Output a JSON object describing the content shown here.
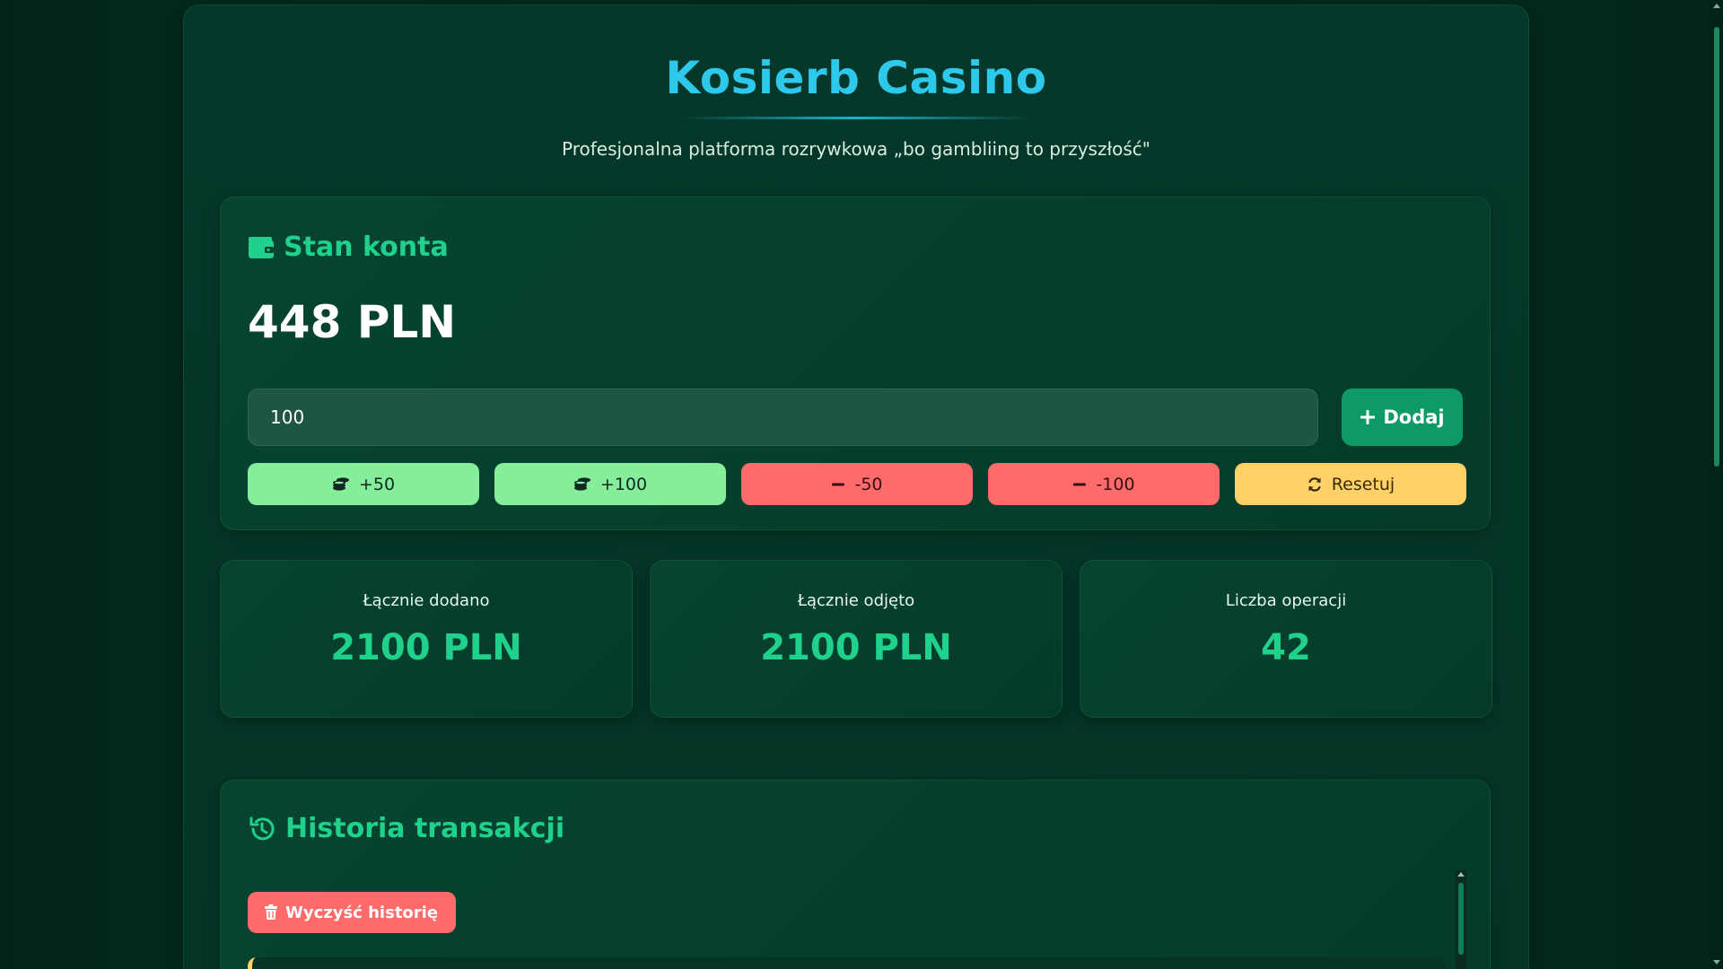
{
  "header": {
    "title": "Kosierb Casino",
    "subtitle": "Profesjonalna platforma rozrywkowa „bo gambliing to przyszłość\""
  },
  "balance": {
    "heading": "Stan konta",
    "heading_icon": "wallet-icon",
    "value": "448 PLN",
    "amount_input_value": "100",
    "add_button_label": "Dodaj",
    "quick_buttons": [
      {
        "label": "+50",
        "icon": "coins-icon"
      },
      {
        "label": "+100",
        "icon": "coins-icon"
      },
      {
        "label": "-50",
        "icon": "minus-icon"
      },
      {
        "label": "-100",
        "icon": "minus-icon"
      },
      {
        "label": "Resetuj",
        "icon": "refresh-icon"
      }
    ]
  },
  "stats": [
    {
      "label": "Łącznie dodano",
      "value": "2100 PLN"
    },
    {
      "label": "Łącznie odjęto",
      "value": "2100 PLN"
    },
    {
      "label": "Liczba operacji",
      "value": "42"
    }
  ],
  "history": {
    "heading": "Historia transakcji",
    "heading_icon": "history-icon",
    "clear_button_label": "Wyczyść historię"
  },
  "colors": {
    "accent_title": "#2ec8ea",
    "accent_green": "#1fd18a",
    "button_green": "#85ee9a",
    "button_red": "#ff6b6b",
    "button_yellow": "#ffd166",
    "add_button": "#0e9a66"
  }
}
